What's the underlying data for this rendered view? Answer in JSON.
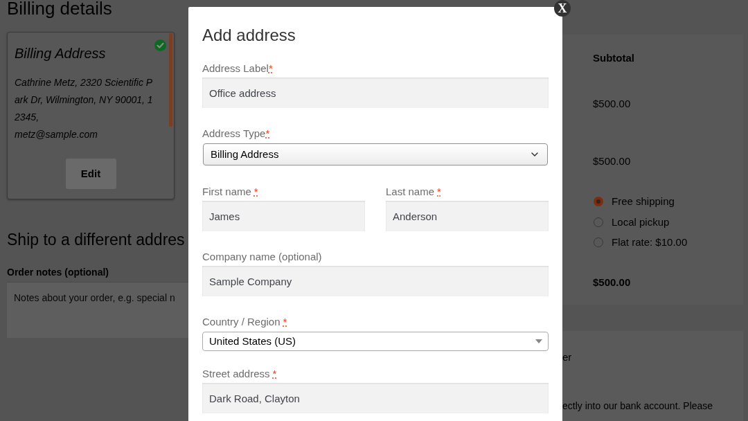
{
  "billing_details": {
    "title": "Billing details",
    "address_card": {
      "title": "Billing Address",
      "selected": true,
      "address": "Cathrine Metz, 2320 Scientific Park Dr, Wilmington, NY 90001, 12345,",
      "email": "metz@sample.com",
      "edit_button": "Edit"
    },
    "ship_to_different": {
      "title": "Ship to a different addres"
    },
    "order_notes": {
      "label": "Order notes (optional)",
      "placeholder": "Notes about your order, e.g. special n"
    }
  },
  "order_summary": {
    "column_header": "Subtotal",
    "amounts": [
      "$500.00",
      "$500.00"
    ],
    "shipping_options": [
      {
        "label": "Free shipping",
        "selected": true
      },
      {
        "label": "Local pickup",
        "selected": false
      },
      {
        "label": "Flat rate: $10.00",
        "selected": false
      }
    ],
    "total": "$500.00"
  },
  "payment": {
    "method": "er",
    "description": "ectly into our bank account. Please"
  },
  "modal": {
    "title": "Add address",
    "close_button": "X",
    "rows": [
      {
        "fields": [
          {
            "kind": "input",
            "label": "Address Label",
            "required_mark": "*",
            "spaced_mark": false,
            "value": "Office address"
          }
        ]
      },
      {
        "fields": [
          {
            "kind": "select",
            "label": "Address Type",
            "required_mark": "*",
            "spaced_mark": false,
            "value": "Billing Address"
          }
        ]
      },
      {
        "fields": [
          {
            "kind": "input",
            "label": "First name",
            "required_mark": "*",
            "spaced_mark": true,
            "value": "James"
          },
          {
            "kind": "input",
            "label": "Last name",
            "required_mark": "*",
            "spaced_mark": true,
            "value": "Anderson"
          }
        ]
      },
      {
        "fields": [
          {
            "kind": "input",
            "label": "Company name (optional)",
            "value": "Sample Company"
          }
        ]
      },
      {
        "fields": [
          {
            "kind": "combo",
            "label": "Country / Region",
            "required_mark": "*",
            "spaced_mark": true,
            "value": "United States (US)"
          }
        ]
      },
      {
        "fields": [
          {
            "kind": "input",
            "label": "Street address",
            "required_mark": "*",
            "spaced_mark": true,
            "value": "Dark Road, Clayton"
          }
        ]
      }
    ]
  }
}
